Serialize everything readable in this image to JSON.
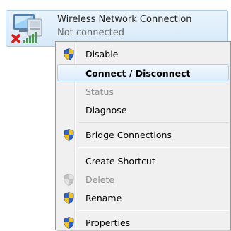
{
  "connection": {
    "name": "Wireless Network Connection",
    "status": "Not connected",
    "icon": "wireless-adapter-icon",
    "status_icon": "red-x-icon"
  },
  "menu": {
    "items": [
      {
        "label": "Disable",
        "icon": "shield-icon",
        "state": "normal"
      },
      {
        "label": "Connect / Disconnect",
        "icon": "",
        "state": "default-hovered"
      },
      {
        "label": "Status",
        "icon": "",
        "state": "disabled"
      },
      {
        "label": "Diagnose",
        "icon": "",
        "state": "normal"
      },
      {
        "label": "Bridge Connections",
        "icon": "shield-icon",
        "state": "normal"
      },
      {
        "label": "Create Shortcut",
        "icon": "",
        "state": "normal"
      },
      {
        "label": "Delete",
        "icon": "shield-icon-disabled",
        "state": "disabled"
      },
      {
        "label": "Rename",
        "icon": "shield-icon",
        "state": "normal"
      },
      {
        "label": "Properties",
        "icon": "shield-icon",
        "state": "normal"
      }
    ]
  },
  "colors": {
    "hover_border": "#a8d0f5",
    "menu_background": "#f0f0f0",
    "disabled_text": "#8e8e8e",
    "tile_background": "#d6e8f7"
  }
}
